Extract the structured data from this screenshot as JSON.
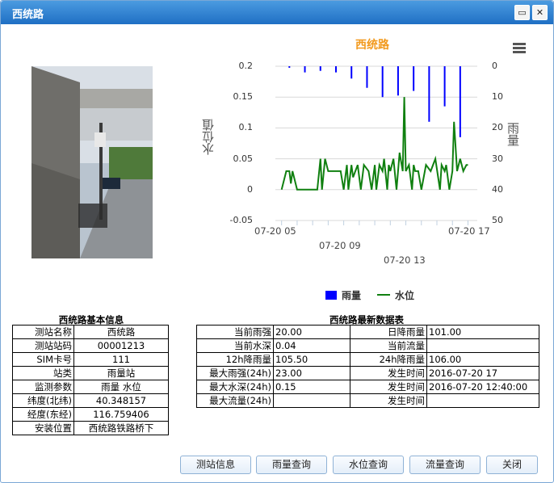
{
  "window": {
    "title": "西统路"
  },
  "title_buttons": {
    "maximize": "▭",
    "close": "✕"
  },
  "chart_data": {
    "type": "bar+line",
    "title": "西统路",
    "left_axis": {
      "label": "水位值",
      "ticks": [
        "0.2",
        "0.15",
        "0.1",
        "0.05",
        "0",
        "-0.05"
      ],
      "range": [
        -0.05,
        0.2
      ]
    },
    "right_axis": {
      "label": "雨量",
      "ticks": [
        "0",
        "10",
        "20",
        "30",
        "40",
        "50"
      ],
      "range": [
        0,
        50
      ],
      "reversed": true
    },
    "x_ticks": [
      "07-20 05",
      "07-20 09",
      "07-20 13",
      "07-20 17"
    ],
    "series": [
      {
        "name": "雨量",
        "type": "bar",
        "color": "#0000ff",
        "x": [
          5.5,
          6.5,
          7.5,
          8.5,
          9.5,
          10.5,
          11.5,
          12.5,
          13.5,
          14.5,
          15.5,
          16.5
        ],
        "values": [
          0.5,
          2.0,
          1.5,
          2.0,
          4.0,
          7.0,
          10.0,
          9.5,
          8.0,
          18.0,
          13.0,
          23.0
        ]
      },
      {
        "name": "水位",
        "type": "line",
        "color": "#108010",
        "x": [
          5.0,
          5.3,
          5.5,
          5.6,
          5.7,
          6.0,
          6.4,
          7.3,
          7.5,
          7.6,
          7.8,
          8.0,
          8.3,
          8.8,
          9.0,
          9.2,
          9.3,
          9.5,
          9.6,
          9.9,
          10.1,
          10.3,
          10.6,
          10.8,
          11.0,
          11.1,
          11.3,
          11.5,
          11.6,
          11.8,
          11.9,
          12.0,
          12.2,
          12.4,
          12.6,
          12.8,
          12.9,
          13.0,
          13.2,
          13.4,
          13.5,
          13.6,
          13.8,
          14.0,
          14.3,
          14.6,
          14.9,
          15.2,
          15.3,
          15.5,
          15.6,
          15.8,
          16.0,
          16.1,
          16.3,
          16.5,
          16.7,
          16.9,
          17.0
        ],
        "values": [
          0,
          0.03,
          0.03,
          0.01,
          0.03,
          0.0,
          0.0,
          0.0,
          0.05,
          0.0,
          0.05,
          0.03,
          0.03,
          0.03,
          0.0,
          0.04,
          0.0,
          0.04,
          0.02,
          0.04,
          0.0,
          0.04,
          0.03,
          0.0,
          0.04,
          0.0,
          0.04,
          0.03,
          0.05,
          0.0,
          0.04,
          0.03,
          0.05,
          0.0,
          0.06,
          0.03,
          0.15,
          0.03,
          0.04,
          0.0,
          0.04,
          0.03,
          0.03,
          0.0,
          0.04,
          0.03,
          0.05,
          0.0,
          0.04,
          0.03,
          0.04,
          0.0,
          0.03,
          0.11,
          0.03,
          0.05,
          0.03,
          0.04,
          0.04
        ]
      }
    ],
    "legend": [
      "雨量",
      "水位"
    ],
    "legend_position": "bottom-center"
  },
  "basic_info": {
    "title": "西统路基本信息",
    "rows": [
      {
        "k": "测站名称",
        "v": "西统路"
      },
      {
        "k": "测站站码",
        "v": "00001213"
      },
      {
        "k": "SIM卡号",
        "v": "111"
      },
      {
        "k": "站类",
        "v": "雨量站"
      },
      {
        "k": "监测参数",
        "v": "雨量 水位"
      },
      {
        "k": "纬度(北纬)",
        "v": "40.348157"
      },
      {
        "k": "经度(东经)",
        "v": "116.759406"
      },
      {
        "k": "安装位置",
        "v": "西统路铁路桥下"
      }
    ]
  },
  "latest_data": {
    "title": "西统路最新数据表",
    "rows": [
      {
        "k1": "当前雨强",
        "v1": "20.00",
        "k2": "日降雨量",
        "v2": "101.00"
      },
      {
        "k1": "当前水深",
        "v1": "0.04",
        "k2": "当前流量",
        "v2": ""
      },
      {
        "k1": "12h降雨量",
        "v1": "105.50",
        "k2": "24h降雨量",
        "v2": "106.00"
      },
      {
        "k1": "最大雨强(24h)",
        "v1": "23.00",
        "k2": "发生时间",
        "v2": "2016-07-20 17"
      },
      {
        "k1": "最大水深(24h)",
        "v1": "0.15",
        "k2": "发生时间",
        "v2": "2016-07-20 12:40:00"
      },
      {
        "k1": "最大流量(24h)",
        "v1": "",
        "k2": "发生时间",
        "v2": ""
      }
    ]
  },
  "buttons": [
    "测站信息",
    "雨量查询",
    "水位查询",
    "流量查询",
    "关闭"
  ]
}
